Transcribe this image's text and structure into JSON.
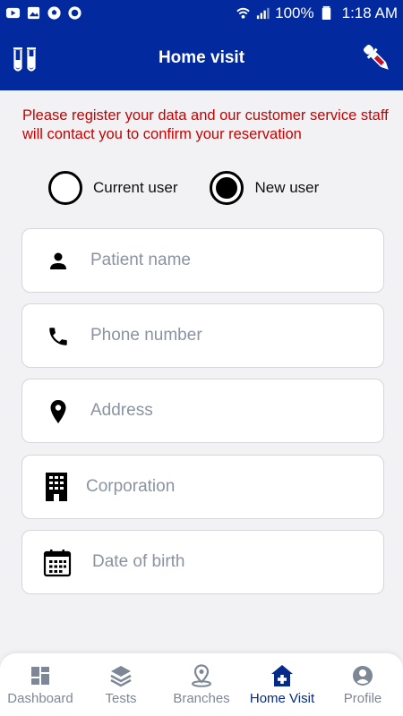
{
  "status_bar": {
    "battery": "100%",
    "time": "1:18 AM",
    "icons": [
      "youtube-icon",
      "gallery-icon",
      "soccer-icon",
      "whatsapp-icon",
      "wifi-icon",
      "signal-icon",
      "battery-icon"
    ]
  },
  "app_bar": {
    "title": "Home visit",
    "left_icon": "test-tubes-icon",
    "right_icon": "dropper-icon"
  },
  "notice": "Please register your data  and our customer service staff will contact  you to confirm your reservation",
  "radio": {
    "options": [
      {
        "label": "Current user",
        "selected": false
      },
      {
        "label": "New user",
        "selected": true
      }
    ]
  },
  "fields": [
    {
      "name": "patient-name",
      "placeholder": "Patient name",
      "value": "",
      "icon": "person-icon"
    },
    {
      "name": "phone-number",
      "placeholder": "Phone number",
      "value": "",
      "icon": "phone-icon"
    },
    {
      "name": "address",
      "placeholder": "Address",
      "value": "",
      "icon": "location-pin-icon"
    },
    {
      "name": "corporation",
      "placeholder": "Corporation",
      "value": "",
      "icon": "building-icon"
    },
    {
      "name": "date-of-birth",
      "placeholder": "Date of birth",
      "value": "",
      "icon": "calendar-icon"
    }
  ],
  "bottom_nav": {
    "items": [
      {
        "label": "Dashboard",
        "icon": "dashboard-icon",
        "active": false
      },
      {
        "label": "Tests",
        "icon": "layers-icon",
        "active": false
      },
      {
        "label": "Branches",
        "icon": "map-pin-icon",
        "active": false
      },
      {
        "label": "Home Visit",
        "icon": "home-plus-icon",
        "active": true
      },
      {
        "label": "Profile",
        "icon": "profile-icon",
        "active": false
      }
    ]
  },
  "colors": {
    "primary": "#022a9e",
    "notice": "#c80000",
    "active_nav": "#062a8a",
    "inactive_nav": "#7d8796"
  }
}
